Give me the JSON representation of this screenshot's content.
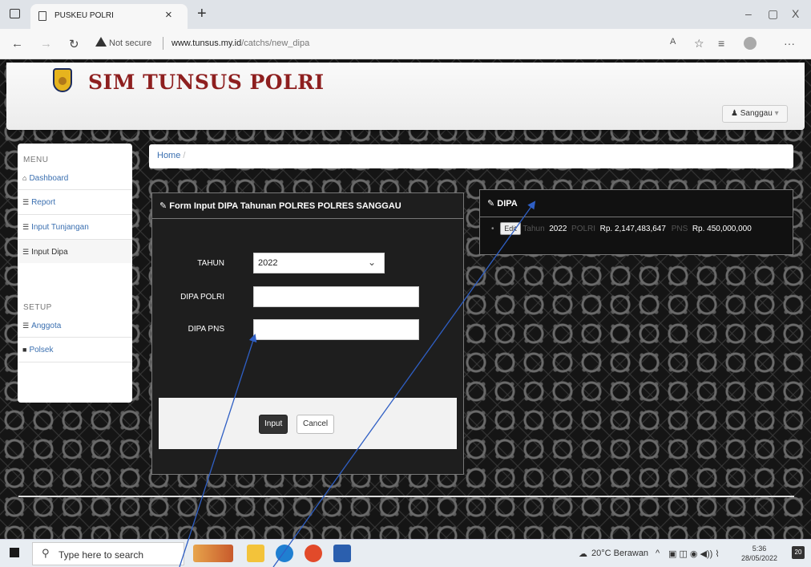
{
  "browser": {
    "tab_title": "PUSKEU POLRI",
    "tab_close": "×",
    "new_tab": "+",
    "not_secure": "Not secure",
    "url_domain": "www.tunsus.my.id",
    "url_path": "/catchs/new_dipa",
    "minimize": "–",
    "maximize": "▢",
    "close": "X"
  },
  "header": {
    "brand": "SIM TUNSUS POLRI",
    "user_label": "Sanggau",
    "user_icon": "user-icon"
  },
  "sidebar": {
    "menu_heading": "MENU",
    "menu_items": [
      {
        "icon": "home-icon",
        "label": "Dashboard"
      },
      {
        "icon": "list-icon",
        "label": "Report"
      },
      {
        "icon": "list-icon",
        "label": "Input Tunjangan"
      },
      {
        "icon": "list-icon",
        "label": "Input Dipa"
      }
    ],
    "setup_heading": "SETUP",
    "setup_items": [
      {
        "icon": "list-icon",
        "label": "Anggota"
      },
      {
        "icon": "comment-icon",
        "label": "Polsek"
      }
    ]
  },
  "breadcrumb": {
    "home": "Home",
    "separator": "/"
  },
  "form": {
    "title": "Form Input DIPA Tahunan POLRES POLRES SANGGAU",
    "tahun_label": "TAHUN",
    "tahun_value": "2022",
    "dipa_polri_label": "DIPA POLRI",
    "dipa_polri_value": "",
    "dipa_pns_label": "DIPA PNS",
    "dipa_pns_value": "",
    "input_button": "Input",
    "cancel_button": "Cancel"
  },
  "dipa": {
    "title": "DIPA",
    "edit_button": "Edit",
    "tahun_label": "Tahun",
    "tahun_value": "2022",
    "polri_label": "POLRI",
    "polri_value": "Rp. 2,147,483,647",
    "pns_label": "PNS",
    "pns_value": "Rp. 450,000,000"
  },
  "taskbar": {
    "search_placeholder": "Type here to search",
    "weather": "20°C Berawan",
    "time": "5:36",
    "date": "28/05/2022",
    "notifications": "20"
  },
  "colors": {
    "brand_red": "#8e1f1f",
    "link_blue": "#3a6fb0",
    "panel_dark": "#1e1e1e",
    "arrow_blue": "#2f5fc4"
  }
}
